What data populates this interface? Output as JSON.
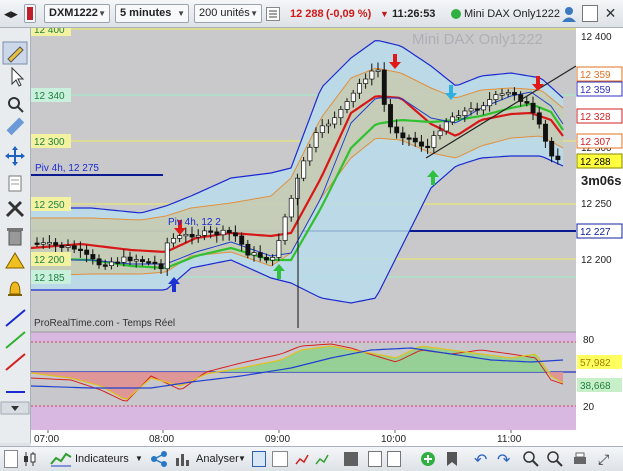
{
  "toolbar": {
    "symbol": "DXM1222",
    "timeframe": "5 minutes",
    "units": "200 unités",
    "price": "12 288",
    "change": "(-0,09 %)",
    "time": "11:26:53",
    "instrument_name": "Mini DAX Only1222"
  },
  "chart": {
    "watermark": "Mini DAX Only1222",
    "credit": "ProRealTime.com - Temps Réel",
    "countdown": "3m06s",
    "pivot_label": "Piv 4h, 12 275",
    "pivot_label2": "Piv 4h, 12 2",
    "y_axis_labels": [
      "12 400",
      "12 350",
      "12 300",
      "12 250",
      "12 200"
    ],
    "left_levels": [
      {
        "text": "12 400",
        "color": "#f2f2a0"
      },
      {
        "text": "12 340",
        "color": "#c8f0dc"
      },
      {
        "text": "12 300",
        "color": "#f2f2a0"
      },
      {
        "text": "12 250",
        "color": "#f2f2a0"
      },
      {
        "text": "12 200",
        "color": "#f2f2a0"
      },
      {
        "text": "12 185",
        "color": "#c8f0dc"
      }
    ],
    "right_tags": [
      {
        "text": "12 359",
        "bg": "#ffffff",
        "fg": "#e07020",
        "border": "#e07020"
      },
      {
        "text": "12 359",
        "bg": "#ffffff",
        "fg": "#3030c0",
        "border": "#3030c0"
      },
      {
        "text": "12 328",
        "bg": "#ffffff",
        "fg": "#d02020",
        "border": "#d02020"
      },
      {
        "text": "12 307",
        "bg": "#ffffff",
        "fg": "#d02020",
        "border": "#e07020"
      },
      {
        "text": "12 288",
        "bg": "#ffff40",
        "fg": "#000000",
        "border": "#888800"
      },
      {
        "text": "12 227",
        "bg": "#ffffff",
        "fg": "#1020a0",
        "border": "#1020a0"
      }
    ],
    "x_axis_labels": [
      "07:00",
      "08:00",
      "09:00",
      "10:00",
      "11:00"
    ]
  },
  "indicator": {
    "y_labels": [
      "80",
      "20"
    ],
    "tags": [
      {
        "text": "57,982",
        "bg": "#ffff60",
        "fg": "#a08000"
      },
      {
        "text": "38,668",
        "bg": "#c8f0c8",
        "fg": "#208040"
      }
    ]
  },
  "bottombar": {
    "indicators_label": "Indicateurs",
    "analyze_label": "Analyser"
  },
  "colors": {
    "bullish_candle": "#ffffff",
    "bearish_candle": "#111111",
    "band_upper": "#1a2ad0",
    "ma_red": "#d81818",
    "ma_green": "#30c030",
    "ma_orange": "#e09040",
    "pivot_line": "#0a1a90"
  }
}
